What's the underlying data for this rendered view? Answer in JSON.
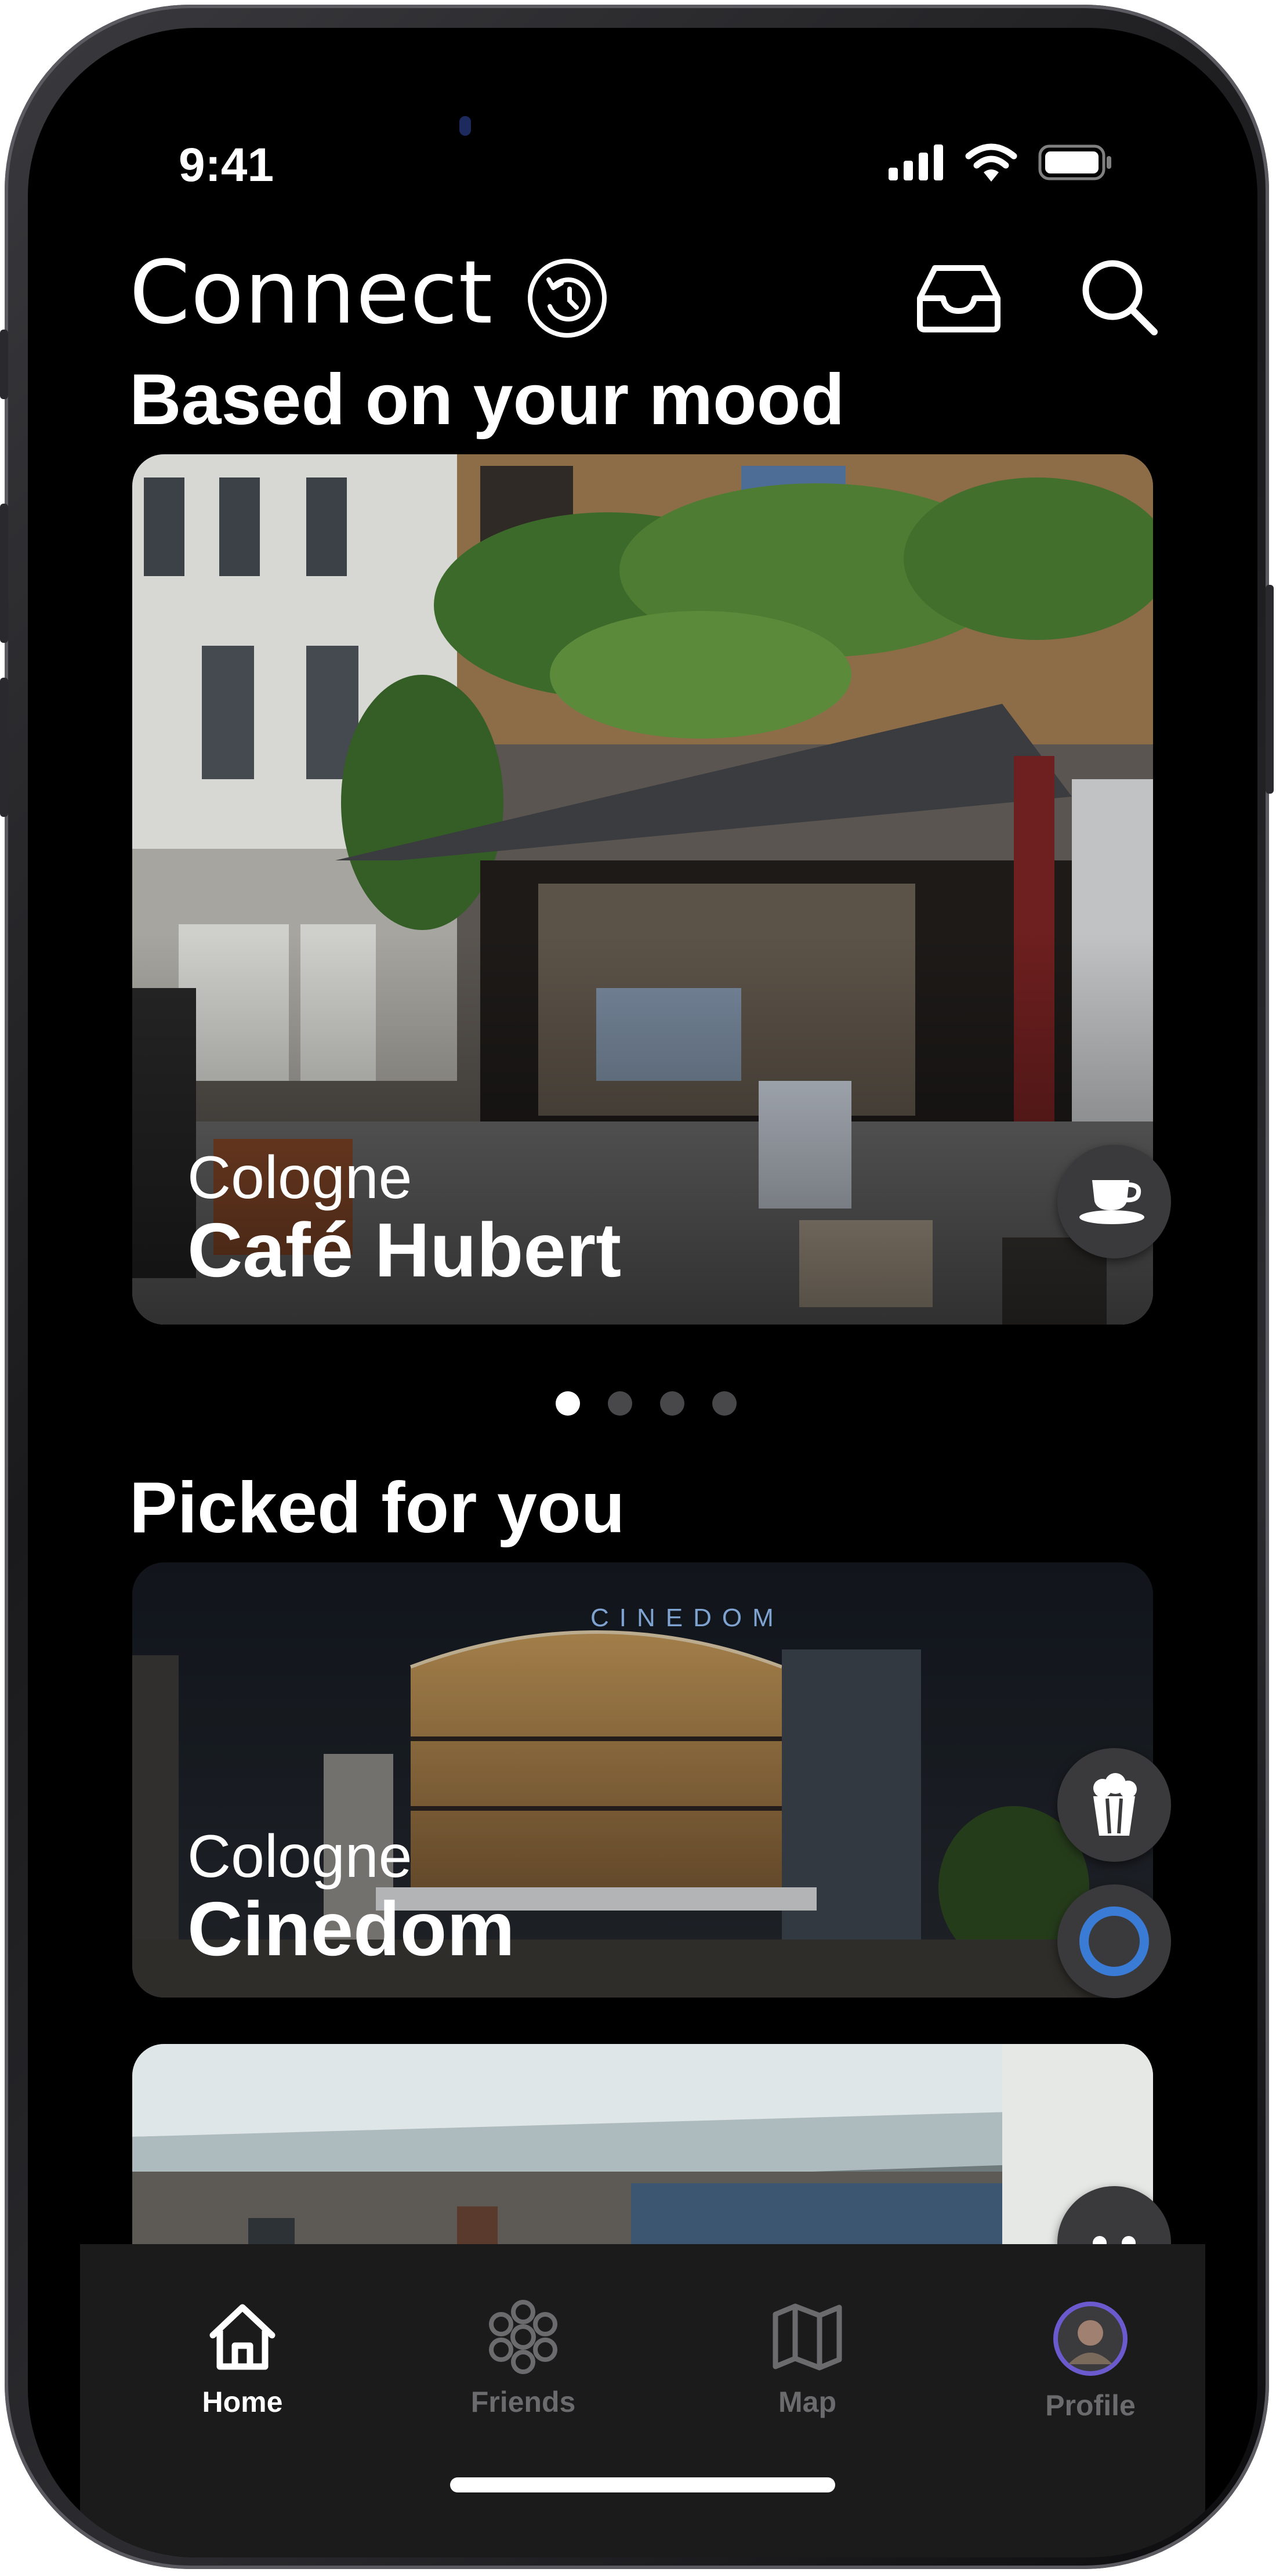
{
  "status_bar": {
    "time": "9:41"
  },
  "header": {
    "title": "Connect"
  },
  "sections": {
    "mood": {
      "title": "Based on your mood"
    },
    "picked": {
      "title": "Picked for you"
    }
  },
  "mood_card": {
    "city": "Cologne",
    "name": "Café Hubert",
    "category_icon": "coffee-cup-icon"
  },
  "carousel": {
    "page_count": 4,
    "active_index": 0
  },
  "picked_cards": [
    {
      "city": "Cologne",
      "name": "Cinedom",
      "category_icon": "popcorn-icon"
    },
    {
      "city": "",
      "name": "",
      "category_icon": "swimming-icon"
    }
  ],
  "tab_bar": {
    "items": [
      {
        "label": "Home",
        "icon": "home-icon",
        "active": true
      },
      {
        "label": "Friends",
        "icon": "friends-icon",
        "active": false
      },
      {
        "label": "Map",
        "icon": "map-icon",
        "active": false
      },
      {
        "label": "Profile",
        "icon": "avatar",
        "active": false
      }
    ]
  },
  "colors": {
    "background": "#000000",
    "accent": "#3a7bd5",
    "tab_inactive": "#6b6b6e"
  }
}
